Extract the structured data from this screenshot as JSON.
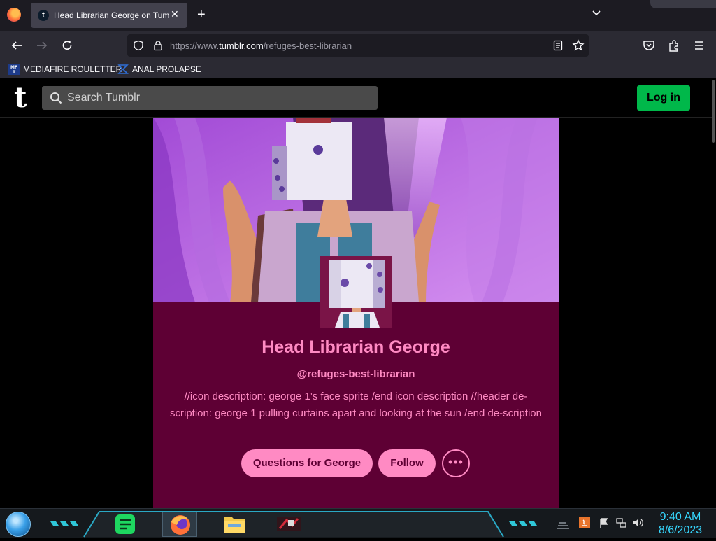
{
  "browser": {
    "tab": {
      "title": "Head Librarian George on Tumblr",
      "close": "✕"
    },
    "newtab": "+",
    "url": {
      "prefix": "https://www.",
      "domain": "tumblr.com",
      "path": "/refuges-best-librarian"
    },
    "bookmarks": [
      {
        "label": "MEDIAFIRE ROULETTER",
        "icon": "mediafire-icon"
      },
      {
        "label": "ANAL PROLAPSE",
        "icon": "sigma-icon"
      }
    ]
  },
  "tumblr": {
    "logo": "t",
    "search_placeholder": "Search Tumblr",
    "login": "Log in",
    "blog": {
      "title": "Head Librarian George",
      "handle": "@refuges-best-librarian",
      "description": "//icon description: george 1’s face sprite /end icon description //header de-scription: george 1 pulling curtains apart and looking at the sun /end de-scription",
      "buttons": {
        "ask": "Questions for George",
        "follow": "Follow",
        "more": "•••"
      }
    }
  },
  "taskbar": {
    "time": "9:40 AM",
    "date": "8/6/2023"
  },
  "colors": {
    "tumblr_accent": "#ff8ac3",
    "blog_bg": "#5e0034",
    "login_green": "#00b84a",
    "clock": "#36d8ff"
  }
}
